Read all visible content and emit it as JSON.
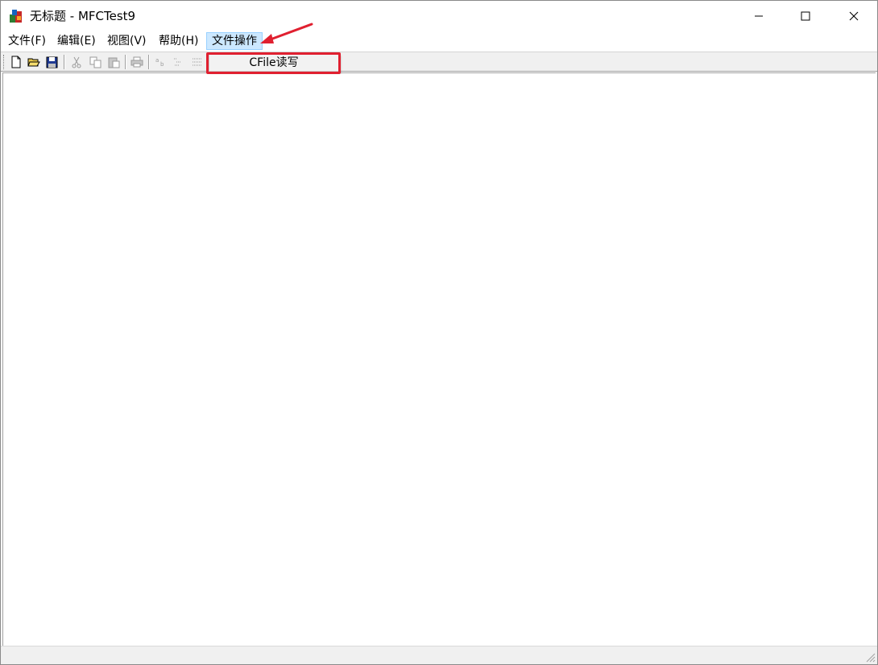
{
  "window": {
    "title": "无标题 - MFCTest9"
  },
  "menu": {
    "items": [
      {
        "label": "文件(F)"
      },
      {
        "label": "编辑(E)"
      },
      {
        "label": "视图(V)"
      },
      {
        "label": "帮助(H)"
      },
      {
        "label": "文件操作"
      }
    ],
    "active_index": 4
  },
  "dropdown": {
    "items": [
      {
        "label": "CFile读写"
      }
    ]
  },
  "toolbar": {
    "buttons": [
      "new-icon",
      "open-icon",
      "save-icon",
      "cut-icon",
      "copy-icon",
      "paste-icon",
      "print-icon",
      "align-left-icon",
      "align-center-icon",
      "align-right-icon"
    ]
  },
  "colors": {
    "highlight": "#e02030",
    "menu_active_bg": "#cce8ff"
  }
}
